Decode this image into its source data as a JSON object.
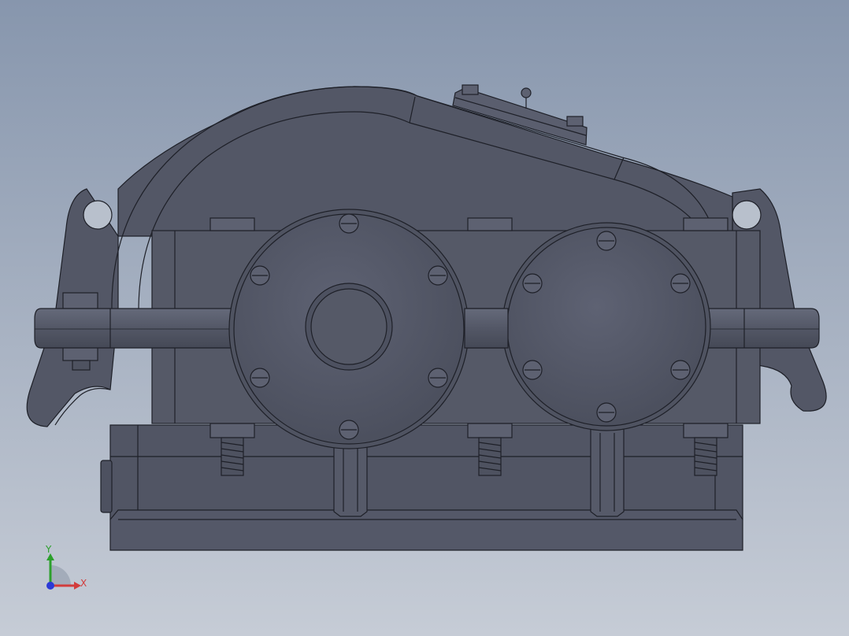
{
  "viewport": {
    "background_top": "#8796ad",
    "background_bottom": "#c6ccd6",
    "model_fill": "#535766",
    "model_fill_light": "#5c6070",
    "model_stroke": "#1e2028"
  },
  "triad": {
    "x_label": "X",
    "y_label": "Y",
    "x_color": "#d23c3c",
    "y_color": "#2ca02c",
    "z_color": "#2b3ad6"
  }
}
